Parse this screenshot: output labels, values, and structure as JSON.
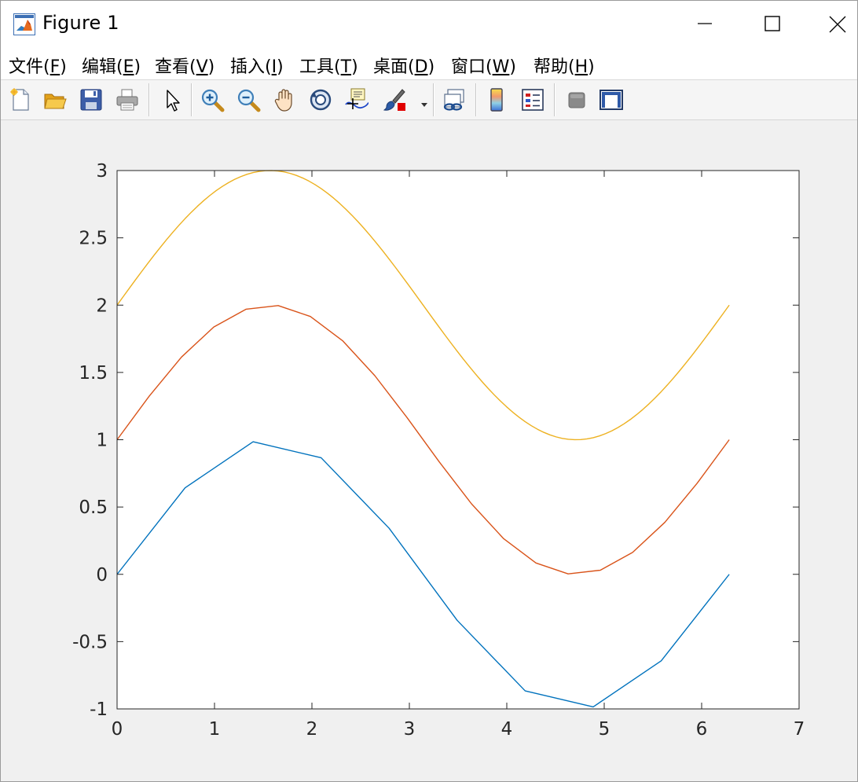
{
  "window": {
    "title": "Figure 1"
  },
  "menu": {
    "items": [
      {
        "label": "文件",
        "mnemonic": "(F)",
        "mn_key": "F"
      },
      {
        "label": "编辑",
        "mnemonic": "(E)",
        "mn_key": "E"
      },
      {
        "label": "查看",
        "mnemonic": "(V)",
        "mn_key": "V"
      },
      {
        "label": "插入",
        "mnemonic": "(I)",
        "mn_key": "I"
      },
      {
        "label": "工具",
        "mnemonic": "(T)",
        "mn_key": "T"
      },
      {
        "label": "桌面",
        "mnemonic": "(D)",
        "mn_key": "D"
      },
      {
        "label": "窗口",
        "mnemonic": "(W)",
        "mn_key": "W"
      },
      {
        "label": "帮助",
        "mnemonic": "(H)",
        "mn_key": "H"
      }
    ]
  },
  "toolbar": {
    "icons": [
      "new-figure-icon",
      "open-file-icon",
      "save-icon",
      "print-icon",
      "edit-plot-arrow-icon",
      "zoom-in-icon",
      "zoom-out-icon",
      "pan-hand-icon",
      "rotate-3d-icon",
      "data-cursor-icon",
      "brush-icon",
      "link-plot-icon",
      "insert-colorbar-icon",
      "insert-legend-icon",
      "hide-plot-tools-icon",
      "show-plot-tools-icon"
    ]
  },
  "colors": {
    "series1": "#0072BD",
    "series2": "#D95319",
    "series3": "#EDB120"
  },
  "chart_data": {
    "type": "line",
    "title": "",
    "xlabel": "",
    "ylabel": "",
    "xlim": [
      0,
      7
    ],
    "ylim": [
      -1,
      3
    ],
    "xticks": [
      "0",
      "1",
      "2",
      "3",
      "4",
      "5",
      "6",
      "7"
    ],
    "yticks": [
      "-1",
      "-0.5",
      "0",
      "0.5",
      "1",
      "1.5",
      "2",
      "2.5",
      "3"
    ],
    "grid": false,
    "box": true,
    "series": [
      {
        "x": [
          0,
          0.6981,
          1.3963,
          2.0944,
          2.7925,
          3.4907,
          4.1888,
          4.8869,
          5.5851,
          6.2832
        ],
        "y": [
          0,
          0.6428,
          0.9848,
          0.866,
          0.342,
          -0.342,
          -0.866,
          -0.9848,
          -0.6428,
          0
        ]
      },
      {
        "x": [
          0,
          0.3307,
          0.6614,
          0.9921,
          1.3228,
          1.6535,
          1.9842,
          2.3149,
          2.6456,
          2.9762,
          3.3069,
          3.6376,
          3.9683,
          4.299,
          4.6297,
          4.9604,
          5.2911,
          5.6218,
          5.9525,
          6.2832
        ],
        "y": [
          1,
          1.3247,
          1.6142,
          1.8372,
          1.9694,
          1.9966,
          1.9158,
          1.7357,
          1.4759,
          1.1646,
          0.8354,
          0.5241,
          0.2643,
          0.0842,
          0.0034,
          0.0306,
          0.1628,
          0.3858,
          0.6753,
          1
        ]
      },
      {
        "function": "sin(x)+2",
        "xmin": 0,
        "xmax": 6.2832,
        "samples": 100
      }
    ]
  }
}
